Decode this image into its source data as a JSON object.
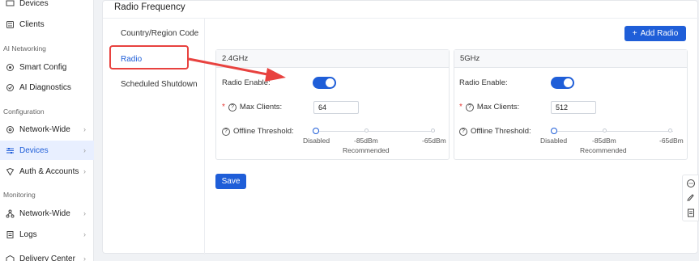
{
  "sidebar": {
    "items": [
      {
        "label": "Devices",
        "icon": "devices-icon"
      },
      {
        "label": "Clients",
        "icon": "clients-icon"
      },
      {
        "label": "Smart Config",
        "icon": "smart-config-icon"
      },
      {
        "label": "AI Diagnostics",
        "icon": "diagnostics-icon"
      },
      {
        "label": "Network-Wide",
        "icon": "network-icon"
      },
      {
        "label": "Devices",
        "icon": "devices-icon"
      },
      {
        "label": "Auth & Accounts",
        "icon": "auth-icon"
      },
      {
        "label": "Network-Wide",
        "icon": "network-icon"
      },
      {
        "label": "Logs",
        "icon": "logs-icon"
      },
      {
        "label": "Delivery Center",
        "icon": "delivery-icon"
      }
    ],
    "sections": [
      "AI Networking",
      "Configuration",
      "Monitoring"
    ],
    "active_color": "#1f5ed8"
  },
  "card": {
    "title": "Radio Frequency",
    "tabs": [
      "Country/Region Code",
      "Radio",
      "Scheduled Shutdown"
    ],
    "add_button": "Add Radio",
    "save_button": "Save"
  },
  "panels": [
    {
      "band": "2.4GHz",
      "radio_enable_label": "Radio Enable:",
      "radio_enabled": true,
      "max_clients_label": "Max Clients:",
      "max_clients_value": "64",
      "offline_threshold_label": "Offline Threshold:",
      "slider_labels": [
        "Disabled",
        "-85dBm",
        "-65dBm"
      ],
      "slider_recommended": "Recommended"
    },
    {
      "band": "5GHz",
      "radio_enable_label": "Radio Enable:",
      "radio_enabled": true,
      "max_clients_label": "Max Clients:",
      "max_clients_value": "512",
      "offline_threshold_label": "Offline Threshold:",
      "slider_labels": [
        "Disabled",
        "-85dBm",
        "-65dBm"
      ],
      "slider_recommended": "Recommended"
    }
  ],
  "colors": {
    "primary": "#1f5ed8",
    "annotation": "#e8423f"
  }
}
